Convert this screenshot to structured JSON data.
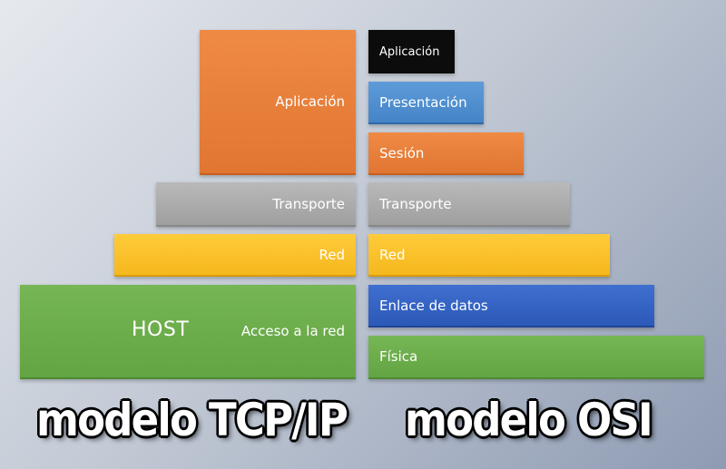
{
  "tcp_model": {
    "title": "modelo TCP/IP",
    "host_label": "HOST",
    "layers": [
      {
        "label": "Aplicación"
      },
      {
        "label": "Transporte"
      },
      {
        "label": "Red"
      },
      {
        "label": "Acceso a la red"
      }
    ]
  },
  "osi_model": {
    "title": "modelo OSI",
    "layers": [
      {
        "label": "Aplicación"
      },
      {
        "label": "Presentación"
      },
      {
        "label": "Sesión"
      },
      {
        "label": "Transporte"
      },
      {
        "label": "Red"
      },
      {
        "label": "Enlace de datos"
      },
      {
        "label": "Física"
      }
    ]
  },
  "colors": {
    "application": "#e07632",
    "presentation": "#4584c6",
    "session": "#e07632",
    "transport": "#a8a8a8",
    "network": "#f5b81e",
    "data_link": "#2c59b8",
    "physical": "#63a443",
    "osi_application": "#0c0c0c"
  }
}
